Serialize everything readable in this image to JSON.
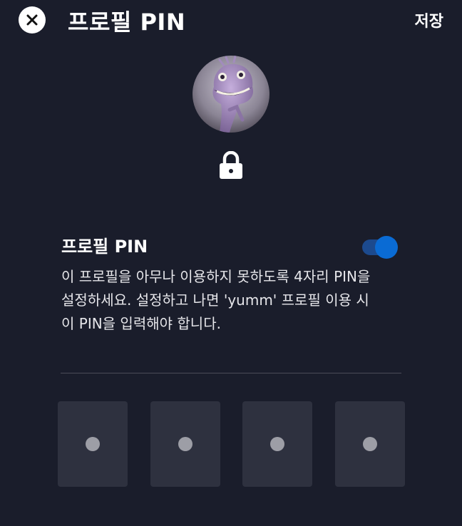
{
  "header": {
    "title": "프로필 PIN",
    "save_label": "저장",
    "close_icon": "close-icon"
  },
  "profile": {
    "avatar_icon": "avatar-lizard-character",
    "lock_icon": "lock-icon"
  },
  "pin_setting": {
    "title": "프로필 PIN",
    "toggle_enabled": true,
    "description": "이 프로필을 아무나 이용하지 못하도록 4자리 PIN을 설정하세요. 설정하고 나면 'yumm' 프로필 이용 시 이 PIN을 입력해야 합니다."
  },
  "pin_input": {
    "digits": 4,
    "filled": [
      false,
      false,
      false,
      false
    ]
  },
  "colors": {
    "background": "#1a1d2b",
    "accent": "#0a6bd4",
    "pin_box": "#2e313f"
  }
}
